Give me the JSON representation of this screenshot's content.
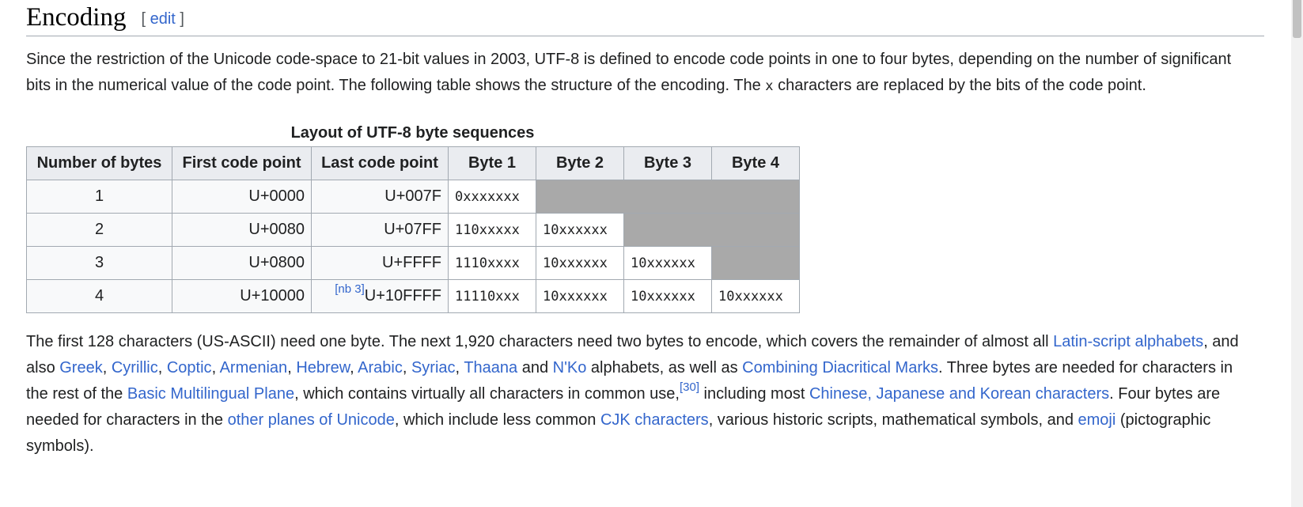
{
  "section": {
    "title": "Encoding",
    "edit_open": "[",
    "edit_label": "edit",
    "edit_close": "]"
  },
  "intro": {
    "part1": "Since the restriction of the Unicode code-space to 21-bit values in 2003, UTF-8 is defined to encode code points in one to four bytes, depending on the number of significant bits in the numerical value of the code point. The following table shows the structure of the encoding. The ",
    "code": "x",
    "part2": " characters are replaced by the bits of the code point."
  },
  "table": {
    "caption": "Layout of UTF-8 byte sequences",
    "headers": [
      "Number of bytes",
      "First code point",
      "Last code point",
      "Byte 1",
      "Byte 2",
      "Byte 3",
      "Byte 4"
    ],
    "rows": [
      {
        "bytes": "1",
        "first": "U+0000",
        "last_note": "",
        "last": "U+007F",
        "b1": "0xxxxxxx",
        "b2": "",
        "b3": "",
        "b4": ""
      },
      {
        "bytes": "2",
        "first": "U+0080",
        "last_note": "",
        "last": "U+07FF",
        "b1": "110xxxxx",
        "b2": "10xxxxxx",
        "b3": "",
        "b4": ""
      },
      {
        "bytes": "3",
        "first": "U+0800",
        "last_note": "",
        "last": "U+FFFF",
        "b1": "1110xxxx",
        "b2": "10xxxxxx",
        "b3": "10xxxxxx",
        "b4": ""
      },
      {
        "bytes": "4",
        "first": "U+10000",
        "last_note": "[nb 3]",
        "last": "U+10FFFF",
        "b1": "11110xxx",
        "b2": "10xxxxxx",
        "b3": "10xxxxxx",
        "b4": "10xxxxxx"
      }
    ]
  },
  "body": {
    "t1": "The first 128 characters (US-ASCII) need one byte. The next 1,920 characters need two bytes to encode, which covers the remainder of almost all ",
    "l_latin": "Latin-script alphabets",
    "t2": ", and also ",
    "l_greek": "Greek",
    "sep1": ", ",
    "l_cyrillic": "Cyrillic",
    "sep2": ", ",
    "l_coptic": "Coptic",
    "sep3": ", ",
    "l_armenian": "Armenian",
    "sep4": ", ",
    "l_hebrew": "Hebrew",
    "sep5": ", ",
    "l_arabic": "Arabic",
    "sep6": ", ",
    "l_syriac": "Syriac",
    "sep7": ", ",
    "l_thaana": "Thaana",
    "t3": " and ",
    "l_nko": "N'Ko",
    "t4": " alphabets, as well as ",
    "l_combining": "Combining Diacritical Marks",
    "t5": ". Three bytes are needed for characters in the rest of the ",
    "l_bmp": "Basic Multilingual Plane",
    "t6": ", which contains virtually all characters in common use,",
    "ref30": "[30]",
    "t7": " including most ",
    "l_cjk1": "Chinese, Japanese and Korean characters",
    "t8": ". Four bytes are needed for characters in the ",
    "l_planes": "other planes of Unicode",
    "t9": ", which include less common ",
    "l_cjk2": "CJK characters",
    "t10": ", various historic scripts, mathematical symbols, and ",
    "l_emoji": "emoji",
    "t11": " (pictographic symbols)."
  }
}
